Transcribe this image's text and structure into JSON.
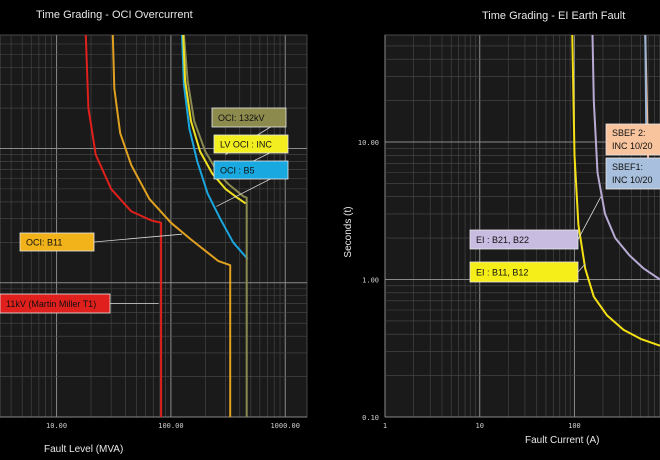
{
  "chart_data": [
    {
      "type": "line",
      "title": "Time Grading - OCI Overcurrent",
      "xlabel": "Fault Level (MVA)",
      "ylabel": "",
      "x_scale": "log",
      "y_scale": "log",
      "xlim": [
        3.2,
        1550
      ],
      "ylim": [
        0.1,
        70
      ],
      "x_ticks": [
        {
          "value": 10,
          "label": "10.00"
        },
        {
          "value": 100,
          "label": "100.00"
        },
        {
          "value": 1000,
          "label": "1000.00"
        }
      ],
      "grid": true,
      "series": [
        {
          "name": "11kV (Martin Miller T1)",
          "color": "#e0201c",
          "points": [
            [
              18,
              70
            ],
            [
              19,
              20
            ],
            [
              22,
              9
            ],
            [
              30,
              5
            ],
            [
              45,
              3.4
            ],
            [
              68,
              2.9
            ],
            [
              82,
              2.8
            ],
            [
              82,
              0.1
            ]
          ]
        },
        {
          "name": "OCI: B11",
          "color": "#e0a020",
          "points": [
            [
              31,
              70
            ],
            [
              32,
              28
            ],
            [
              36,
              13
            ],
            [
              45,
              7.5
            ],
            [
              65,
              4.2
            ],
            [
              100,
              2.8
            ],
            [
              150,
              2.1
            ],
            [
              260,
              1.45
            ],
            [
              330,
              1.35
            ],
            [
              330,
              0.1
            ]
          ]
        },
        {
          "name": "OCI : B5",
          "color": "#1aa7df",
          "points": [
            [
              125,
              70
            ],
            [
              130,
              30
            ],
            [
              145,
              14
            ],
            [
              170,
              8
            ],
            [
              210,
              4.6
            ],
            [
              270,
              3.0
            ],
            [
              350,
              2.0
            ],
            [
              470,
              1.5
            ]
          ]
        },
        {
          "name": "OCI: 132kV",
          "color": "#8a8a50",
          "points": [
            [
              130,
              70
            ],
            [
              140,
              32
            ],
            [
              160,
              16
            ],
            [
              200,
              9.5
            ],
            [
              260,
              6.5
            ],
            [
              320,
              5.4
            ],
            [
              430,
              4.4
            ],
            [
              460,
              4.3
            ],
            [
              460,
              0.1
            ]
          ]
        },
        {
          "name": "LV OCI : INC",
          "color": "#f0e020",
          "points": [
            [
              128,
              70
            ],
            [
              133,
              32
            ],
            [
              150,
              16
            ],
            [
              180,
              9.5
            ],
            [
              230,
              6.5
            ],
            [
              300,
              5.0
            ],
            [
              380,
              4.3
            ],
            [
              450,
              3.9
            ]
          ]
        }
      ],
      "annotations": [
        {
          "text": "OCI: 132kV",
          "fill": "#8c8a4c",
          "anchor": [
            300,
            9.0
          ]
        },
        {
          "text": "LV OCI : INC",
          "fill": "#f2ee20",
          "anchor": [
            260,
            6.0
          ]
        },
        {
          "text": "OCI : B5",
          "fill": "#19a8e0",
          "anchor": [
            250,
            3.7
          ]
        },
        {
          "text": "OCI: B11",
          "fill": "#f1b21a",
          "anchor": [
            125,
            2.3
          ]
        },
        {
          "text": "11kV (Martin Miller T1)",
          "fill": "#e0201c",
          "anchor": [
            78,
            0.7
          ]
        }
      ]
    },
    {
      "type": "line",
      "title": "Time Grading - EI Earth Fault",
      "xlabel": "Fault Current (A)",
      "ylabel": "Seconds (t)",
      "x_scale": "log",
      "y_scale": "log",
      "xlim": [
        1,
        800
      ],
      "ylim": [
        0.1,
        60
      ],
      "x_ticks": [
        {
          "value": 1,
          "label": "1"
        },
        {
          "value": 10,
          "label": "10"
        },
        {
          "value": 100,
          "label": "100"
        }
      ],
      "y_ticks": [
        {
          "value": 0.1,
          "label": "0.10"
        },
        {
          "value": 1,
          "label": "1.00"
        },
        {
          "value": 10,
          "label": "10.00"
        }
      ],
      "grid": true,
      "series": [
        {
          "name": "EI : B11, B12",
          "color": "#f5e014",
          "points": [
            [
              95,
              60
            ],
            [
              100,
              8
            ],
            [
              110,
              2.5
            ],
            [
              130,
              1.2
            ],
            [
              160,
              0.75
            ],
            [
              220,
              0.55
            ],
            [
              330,
              0.43
            ],
            [
              500,
              0.37
            ],
            [
              800,
              0.33
            ]
          ]
        },
        {
          "name": "EI : B21, B22",
          "color": "#b8aad4",
          "points": [
            [
              155,
              60
            ],
            [
              160,
              20
            ],
            [
              175,
              6
            ],
            [
              210,
              3
            ],
            [
              270,
              2.0
            ],
            [
              380,
              1.5
            ],
            [
              540,
              1.2
            ],
            [
              800,
              1.0
            ]
          ]
        },
        {
          "name": "SBEF 2: INC 10/20",
          "color": "#f2b48a",
          "points": [
            [
              560,
              60
            ],
            [
              600,
              7
            ]
          ]
        },
        {
          "name": "SBEF1: INC 10/20",
          "color": "#9bb6d6",
          "points": [
            [
              560,
              60
            ],
            [
              575,
              10
            ]
          ]
        }
      ],
      "annotations": [
        {
          "text": "SBEF 2:",
          "text2": "INC 10/20",
          "fill": "#f7c49e",
          "anchor": [
            560,
            9
          ]
        },
        {
          "text": "SBEF1:",
          "text2": "INC 10/20",
          "fill": "#a8c0dd",
          "anchor": [
            560,
            4
          ]
        },
        {
          "text": "EI : B21, B22",
          "fill": "#c8bde0",
          "anchor": [
            190,
            4.0
          ]
        },
        {
          "text": "EI : B11, B12",
          "fill": "#f5ee18",
          "anchor": [
            130,
            1.3
          ]
        }
      ]
    }
  ]
}
